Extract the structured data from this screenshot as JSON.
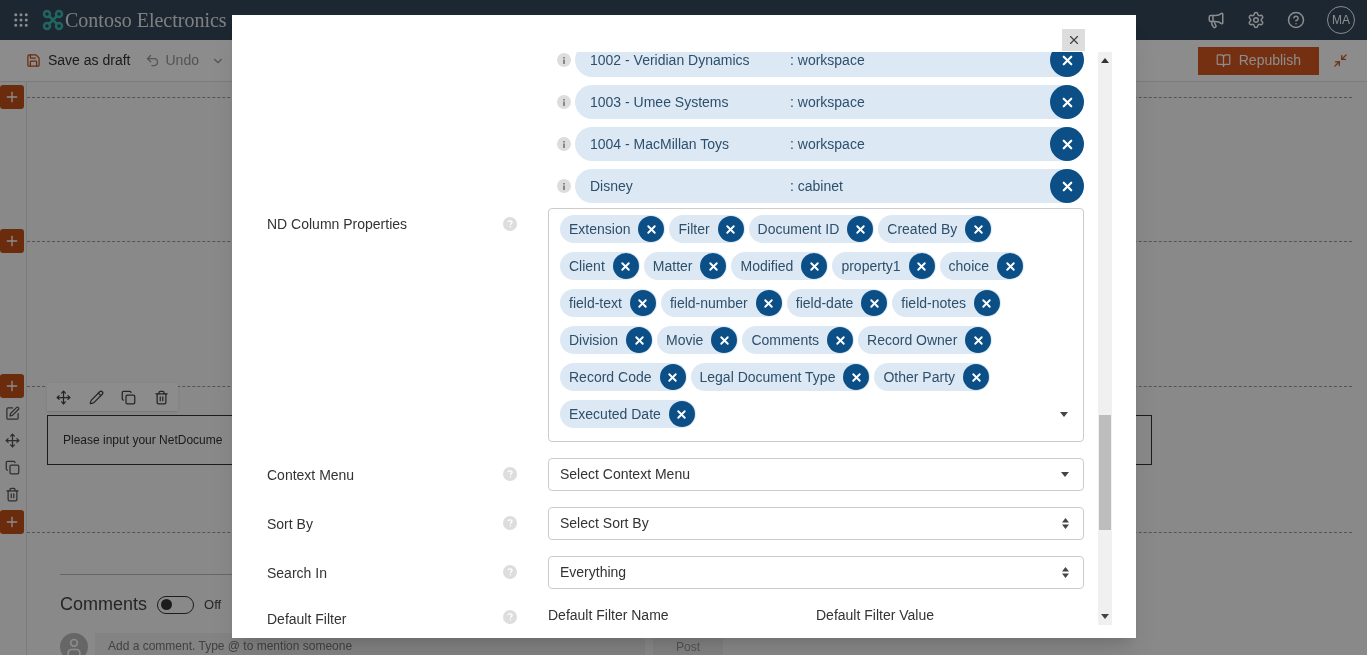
{
  "header": {
    "logo": "Contoso Electronics",
    "avatar": "MA"
  },
  "toolbar": {
    "save": "Save as draft",
    "undo": "Undo",
    "republish": "Republish"
  },
  "canvas": {
    "text_webpart": "Please input your NetDocume"
  },
  "comments": {
    "title": "Comments",
    "toggle": {
      "on": false,
      "label": "Off"
    },
    "placeholder": "Add a comment. Type @ to mention someone",
    "post": "Post"
  },
  "dialog": {
    "locations": [
      {
        "name": "1002 - Veridian Dynamics",
        "type": ": workspace"
      },
      {
        "name": "1003 - Umee Systems",
        "type": ": workspace"
      },
      {
        "name": "1004 - MacMillan Toys",
        "type": ": workspace"
      },
      {
        "name": "Disney",
        "type": ": cabinet"
      }
    ],
    "fields": [
      {
        "kind": "tags",
        "label": "ND Column Properties",
        "tags": [
          "Extension",
          "Filter",
          "Document ID",
          "Created By",
          "Client",
          "Matter",
          "Modified",
          "property1",
          "choice",
          "field-text",
          "field-number",
          "field-date",
          "field-notes",
          "Division",
          "Movie",
          "Comments",
          "Record Owner",
          "Record Code",
          "Legal Document Type",
          "Other Party",
          "Executed Date"
        ]
      },
      {
        "kind": "dropdown",
        "label": "Context Menu",
        "value": "Select Context Menu"
      },
      {
        "kind": "select",
        "label": "Sort By",
        "value": "Select Sort By"
      },
      {
        "kind": "select",
        "label": "Search In",
        "value": "Everything"
      },
      {
        "kind": "pair",
        "label": "Default Filter",
        "columns": [
          "Default Filter Name",
          "Default Filter Value"
        ]
      }
    ]
  }
}
